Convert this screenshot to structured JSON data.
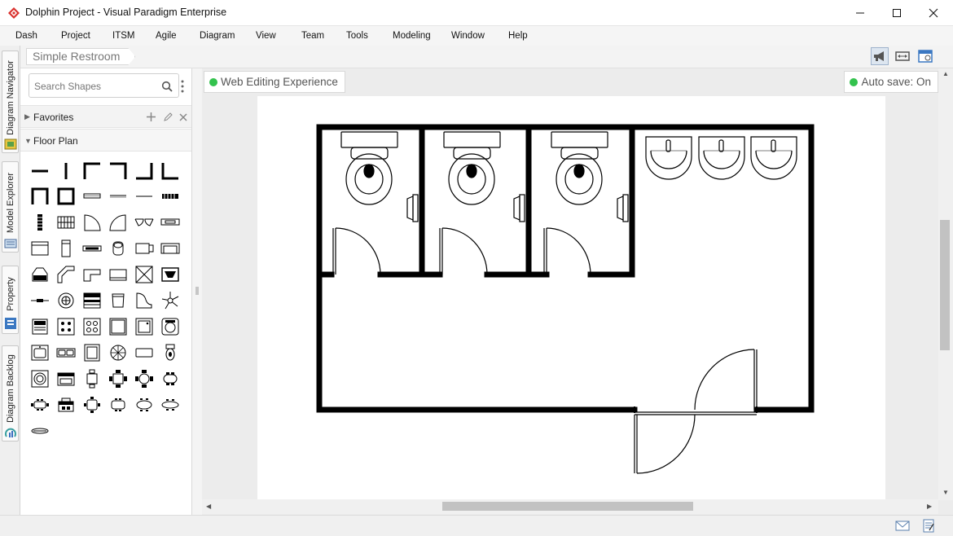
{
  "window": {
    "title": "Dolphin Project - Visual Paradigm Enterprise",
    "controls": [
      "minimize-icon",
      "maximize-icon",
      "close-icon"
    ]
  },
  "menu": [
    "Dash",
    "Project",
    "ITSM",
    "Agile",
    "Diagram",
    "View",
    "Team",
    "Tools",
    "Modeling",
    "Window",
    "Help"
  ],
  "left_tabs": [
    "Diagram Navigator",
    "Model Explorer",
    "Property",
    "Diagram Backlog"
  ],
  "breadcrumb": "Simple Restroom",
  "search": {
    "placeholder": "Search Shapes"
  },
  "categories": [
    {
      "label": "Favorites",
      "expanded": false
    },
    {
      "label": "Floor Plan",
      "expanded": true
    }
  ],
  "canvas": {
    "web_badge": "Web Editing Experience",
    "autosave": "Auto save: On",
    "status_color": "#33c24d"
  },
  "colors": {
    "accent": "#d9302c",
    "wall": "#000000"
  }
}
